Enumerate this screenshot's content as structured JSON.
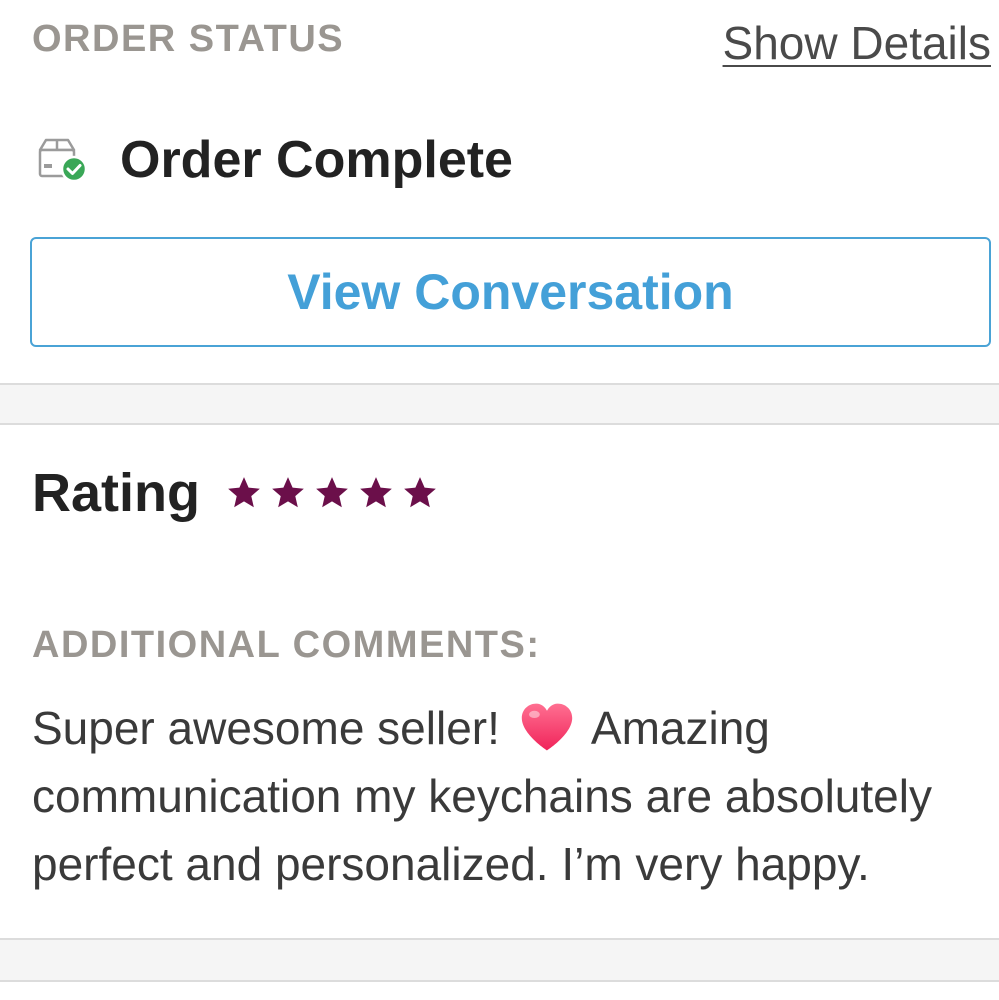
{
  "order_status": {
    "section_label": "ORDER STATUS",
    "show_details_label": "Show Details",
    "status_title": "Order Complete",
    "status_icon": "box-check-icon",
    "view_conversation_label": "View Conversation"
  },
  "rating": {
    "label": "Rating",
    "stars": 5,
    "max_stars": 5,
    "star_color": "#6b0f4a"
  },
  "comments": {
    "label": "ADDITIONAL COMMENTS:",
    "text_before_emoji": "Super awesome seller!",
    "emoji": "heart-icon",
    "text_after_emoji": "Amazing communication my keychains are absolutely perfect and personalized. I’m very happy."
  },
  "colors": {
    "accent_blue": "#44a0d8",
    "check_green": "#3aa757",
    "label_gray": "#9a9691"
  }
}
